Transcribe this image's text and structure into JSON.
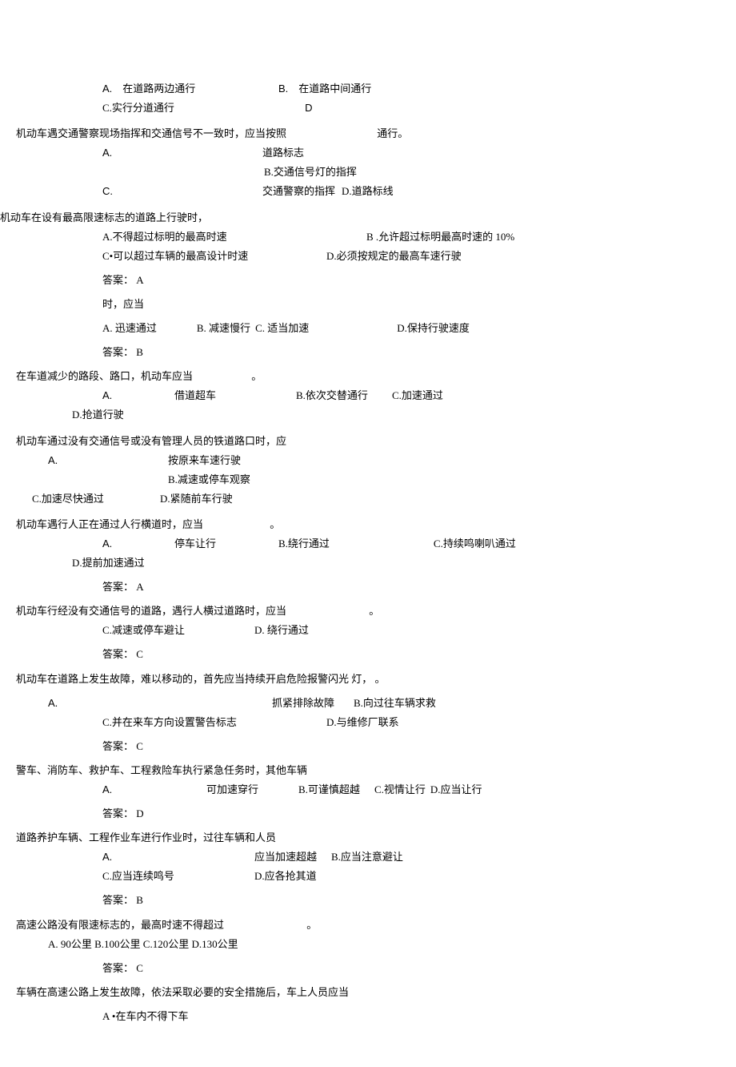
{
  "q1": {
    "optA_label": "A.",
    "optA_text": "在道路两边通行",
    "optB_label": "B.",
    "optB_text": "在道路中间通行",
    "optC": "C.实行分道通行",
    "optD_partial": "D"
  },
  "q2": {
    "stem": "机动车遇交通警察现场指挥和交通信号不一致时，应当按照",
    "stem_end": "通行。",
    "optA_label": "A.",
    "optA_text": "道路标志",
    "optB": "B.交通信号灯的指挥",
    "optC_label": "C.",
    "optC_text": "交通警察的指挥",
    "optD": "D.道路标线"
  },
  "q3": {
    "stem": "机动车在设有最高限速标志的道路上行驶时，",
    "optA": "A.不得超过标明的最高时速",
    "optB": "B .允许超过标明最高时速的 10%",
    "optC": "C•可以超过车辆的最高设计时速",
    "optD": "D.必须按规定的最高车速行驶",
    "answer": "答案：  A"
  },
  "q4": {
    "stem": "时，应当",
    "optA": "A. 迅速通过",
    "optB": "B. 减速慢行",
    "optC": "C. 适当加速",
    "optD": "D.保持行驶速度",
    "answer": "答案：  B"
  },
  "q5": {
    "stem": "在车道减少的路段、路口，机动车应当",
    "stem_end": "。",
    "optA_label": "A.",
    "optA_text": "借道超车",
    "optB": "B.依次交替通行",
    "optC": "C.加速通过",
    "optD": "D.抢道行驶"
  },
  "q6": {
    "stem": "机动车通过没有交通信号或没有管理人员的铁道路口时，应",
    "optA_label": "A.",
    "optA_text": "按原来车速行驶",
    "optB": "B.减速或停车观察",
    "optC": "C.加速尽快通过",
    "optD": "D.紧随前车行驶"
  },
  "q7": {
    "stem": "机动车遇行人正在通过人行横道时，应当",
    "stem_end": "。",
    "optA_label": "A.",
    "optA_text": "停车让行",
    "optB": "B.绕行通过",
    "optC": "C.持续鸣喇叭通过",
    "optD": "D.提前加速通过",
    "answer": "答案：  A"
  },
  "q8": {
    "stem": "机动车行经没有交通信号的道路，遇行人横过道路时，应当",
    "stem_end": "。",
    "optC": "C.减速或停车避让",
    "optD": "D. 绕行通过",
    "answer": "答案：  C"
  },
  "q9": {
    "stem": "机动车在道路上发生故障，难以移动的，首先应当持续开启危险报警闪光  灯，  。",
    "optA_label": "A.",
    "optA_text": "抓紧排除故障",
    "optB": "B.向过往车辆求救",
    "optC": "C.并在来车方向设置警告标志",
    "optD": "D.与维修厂联系",
    "answer": "答案：  C"
  },
  "q10": {
    "stem": "警车、消防车、救护车、工程救险车执行紧急任务时，其他车辆",
    "optA_label": "A.",
    "optA_text": "可加速穿行",
    "optB": "B.可谨慎超越",
    "optC": "C.视情让行",
    "optD": "D.应当让行",
    "answer": "答案：  D"
  },
  "q11": {
    "stem": "道路养护车辆、工程作业车进行作业时，过往车辆和人员",
    "optA_label": "A.",
    "optA_text": "应当加速超越",
    "optB": "B.应当注意避让",
    "optC": "C.应当连续鸣号",
    "optD": "D.应各抢其道",
    "answer": "答案：  B"
  },
  "q12": {
    "stem": "高速公路没有限速标志的，最高时速不得超过",
    "stem_end": "。",
    "opts": "A.   90公里 B.100公里 C.120公里 D.130公里",
    "answer": "答案：  C"
  },
  "q13": {
    "stem": "车辆在高速公路上发生故障，依法采取必要的安全措施后，车上人员应当",
    "optA": "A •在车内不得下车"
  }
}
